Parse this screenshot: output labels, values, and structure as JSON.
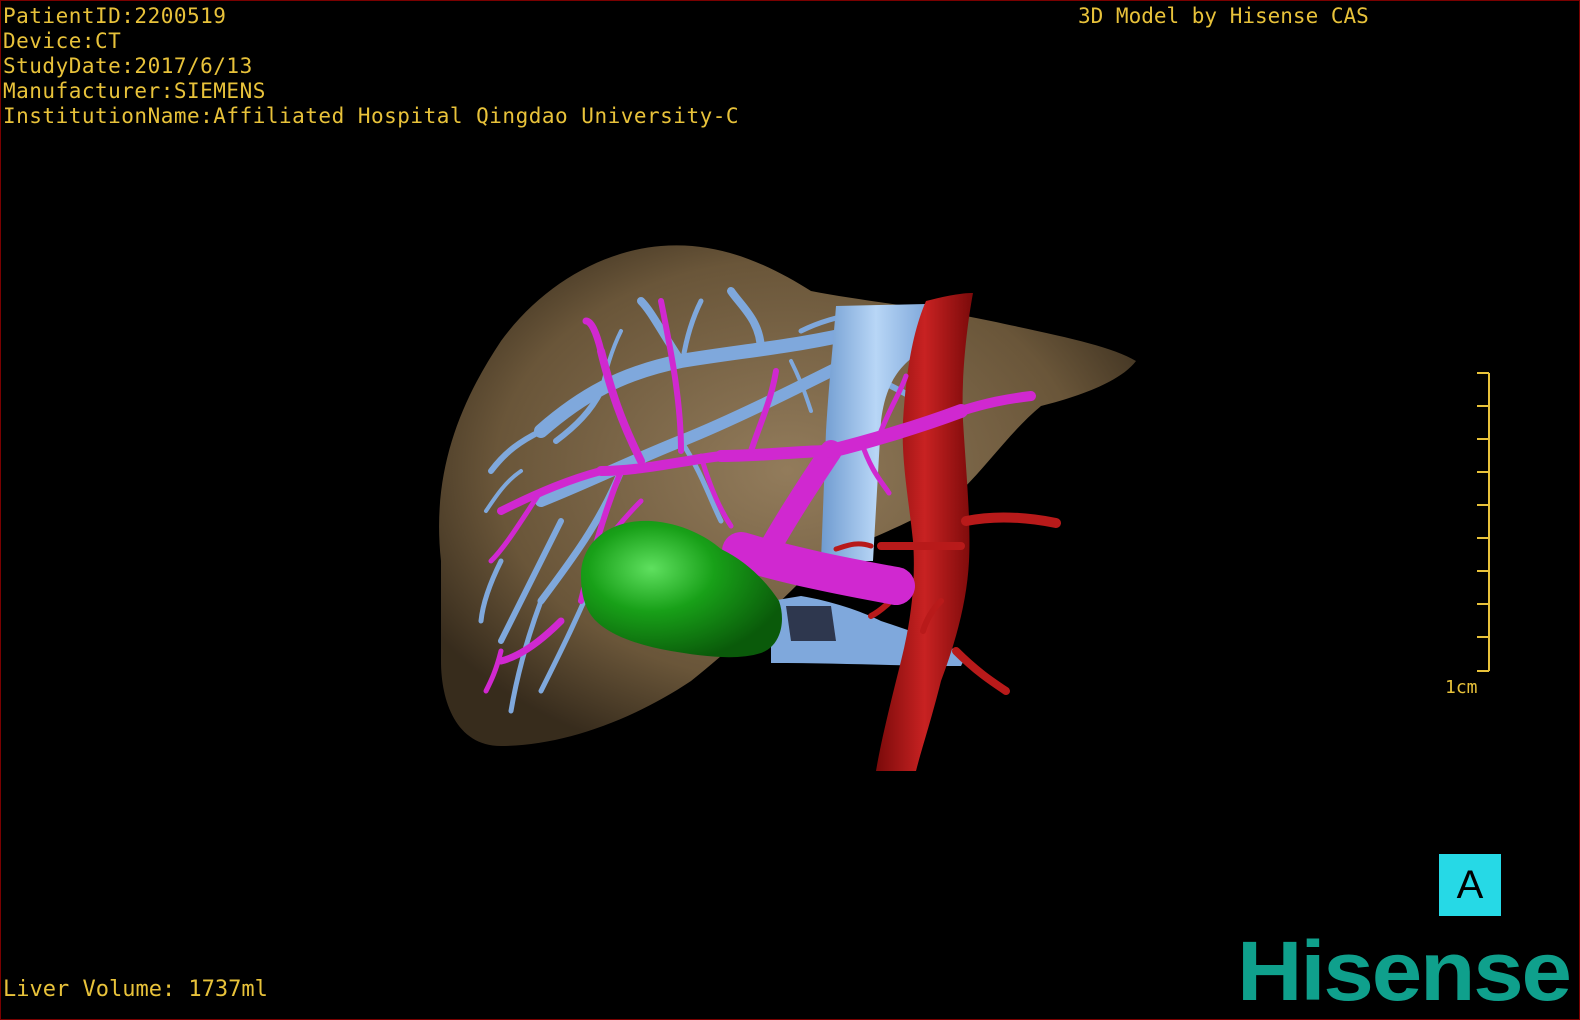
{
  "header": {
    "patient_id": "PatientID:2200519",
    "device": "Device:CT",
    "study_date": "StudyDate:2017/6/13",
    "manufacturer": "Manufacturer:SIEMENS",
    "institution": "InstitutionName:Affiliated Hospital Qingdao University-C",
    "credit": "3D Model by Hisense CAS"
  },
  "scale_bar": {
    "label": "1cm",
    "ticks": 10
  },
  "orientation": {
    "label": "A"
  },
  "footer": {
    "liver_volume": "Liver Volume: 1737ml"
  },
  "brand": {
    "logo_text": "Hisense"
  },
  "colors": {
    "overlay_text": "#e8c23a",
    "liver": "#8a7250",
    "hepatic_vein": "#8cb8e8",
    "portal_vein": "#d028d0",
    "artery": "#b01818",
    "gallbladder": "#1aa01a",
    "orientation_box": "#26d9e6",
    "logo": "#0fa08c"
  }
}
